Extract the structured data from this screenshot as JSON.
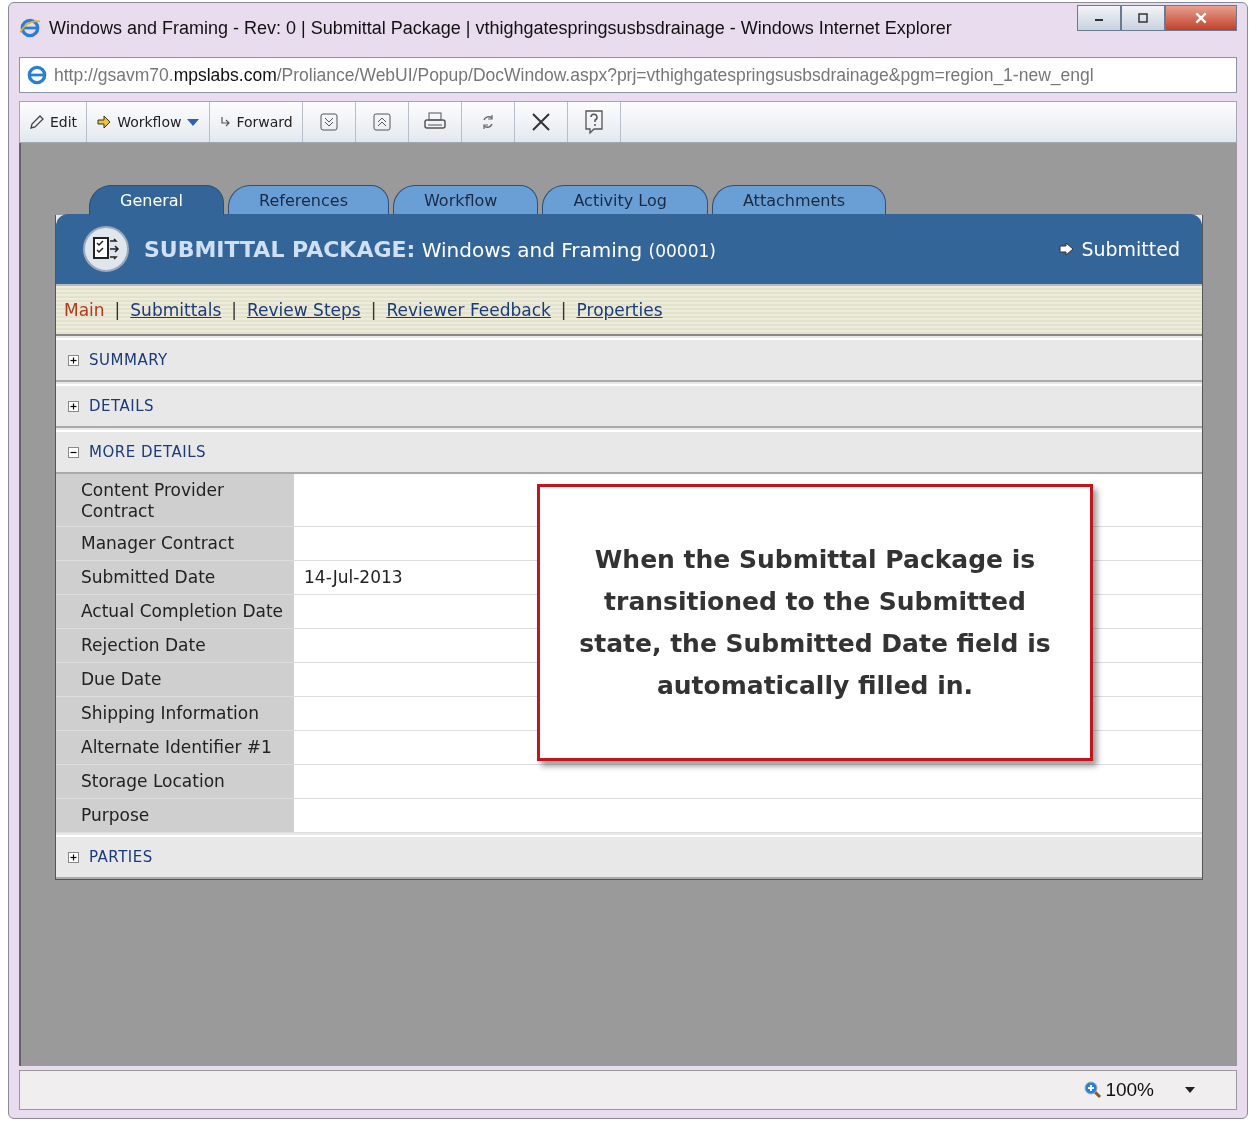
{
  "window": {
    "title": "Windows and Framing - Rev: 0 | Submittal Package | vthighgatespringsusbsdrainage - Windows Internet Explorer"
  },
  "address_bar": {
    "prefix": "http://gsavm70.",
    "domain": "mpslabs.com",
    "path": "/Proliance/WebUI/Popup/DocWindow.aspx?prj=vthighgatespringsusbsdrainage&pgm=region_1-new_engl"
  },
  "toolbar": [
    {
      "label": "Edit",
      "has_menu": false
    },
    {
      "label": "Workflow",
      "has_menu": true
    },
    {
      "label": "Forward",
      "has_menu": false
    }
  ],
  "tabs": [
    {
      "label": "General",
      "selected": true
    },
    {
      "label": "References",
      "selected": false
    },
    {
      "label": "Workflow",
      "selected": false
    },
    {
      "label": "Activity Log",
      "selected": false
    },
    {
      "label": "Attachments",
      "selected": false
    }
  ],
  "header": {
    "type": "SUBMITTAL PACKAGE:",
    "name": "Windows and Framing",
    "number": "(00001)",
    "status": "Submitted"
  },
  "subnav": {
    "links": [
      {
        "label": "Main",
        "selected": true
      },
      {
        "label": "Submittals",
        "selected": false
      },
      {
        "label": "Review Steps",
        "selected": false
      },
      {
        "label": "Reviewer Feedback",
        "selected": false
      },
      {
        "label": "Properties",
        "selected": false
      }
    ],
    "separators": [
      "|",
      "|",
      "|",
      "|"
    ]
  },
  "sections": [
    {
      "title": "SUMMARY",
      "expanded": false
    },
    {
      "title": "DETAILS",
      "expanded": false
    },
    {
      "title": "MORE DETAILS",
      "expanded": true,
      "fields": [
        {
          "label": "Content Provider Contract"
        },
        {
          "label": "Manager Contract"
        },
        {
          "label": "Submitted Date",
          "value": "14-Jul-2013"
        },
        {
          "label": "Actual Completion Date"
        },
        {
          "label": "Rejection Date"
        },
        {
          "label": "Due Date"
        },
        {
          "label": "Shipping Information"
        },
        {
          "label": "Alternate Identifier #1"
        },
        {
          "label": "Storage Location"
        },
        {
          "label": "Purpose"
        }
      ]
    },
    {
      "title": "PARTIES",
      "expanded": false
    }
  ],
  "callout": {
    "text": "When the Submittal Package is transitioned to the Submitted state, the Submitted Date field is automatically filled in."
  },
  "status_bar": {
    "zoom": "100%"
  }
}
